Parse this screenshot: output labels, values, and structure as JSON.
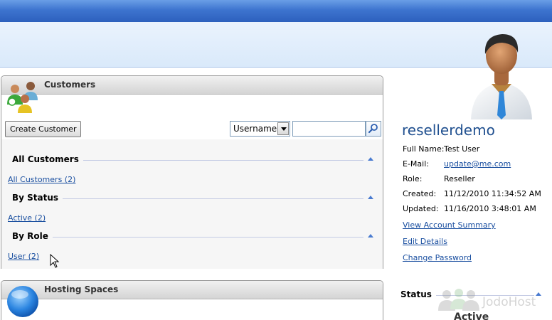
{
  "customers_panel": {
    "title": "Customers",
    "create_button": "Create Customer",
    "search_select": "Username",
    "search_value": "",
    "groups": [
      {
        "title": "All Customers",
        "link": "All Customers (2)"
      },
      {
        "title": "By Status",
        "link": "Active (2)"
      },
      {
        "title": "By Role",
        "link": "User (2)"
      }
    ]
  },
  "hosting_panel": {
    "title": "Hosting Spaces"
  },
  "account": {
    "username": "resellerdemo",
    "full_name_label": "Full Name:",
    "full_name": "Test User",
    "email_label": "E-Mail:",
    "email": "update@me.com",
    "role_label": "Role:",
    "role": "Reseller",
    "created_label": "Created:",
    "created": "11/12/2010 11:34:52 AM",
    "updated_label": "Updated:",
    "updated": "11/16/2010 3:48:01 AM",
    "links": [
      "View Account Summary",
      "Edit Details",
      "Change Password"
    ]
  },
  "status": {
    "title": "Status",
    "value": "Active"
  },
  "watermark": {
    "text": "JodoHost"
  },
  "colors": {
    "accent": "#2d60bd",
    "link": "#1a4fa0",
    "header_band": "#d9e9fa"
  }
}
